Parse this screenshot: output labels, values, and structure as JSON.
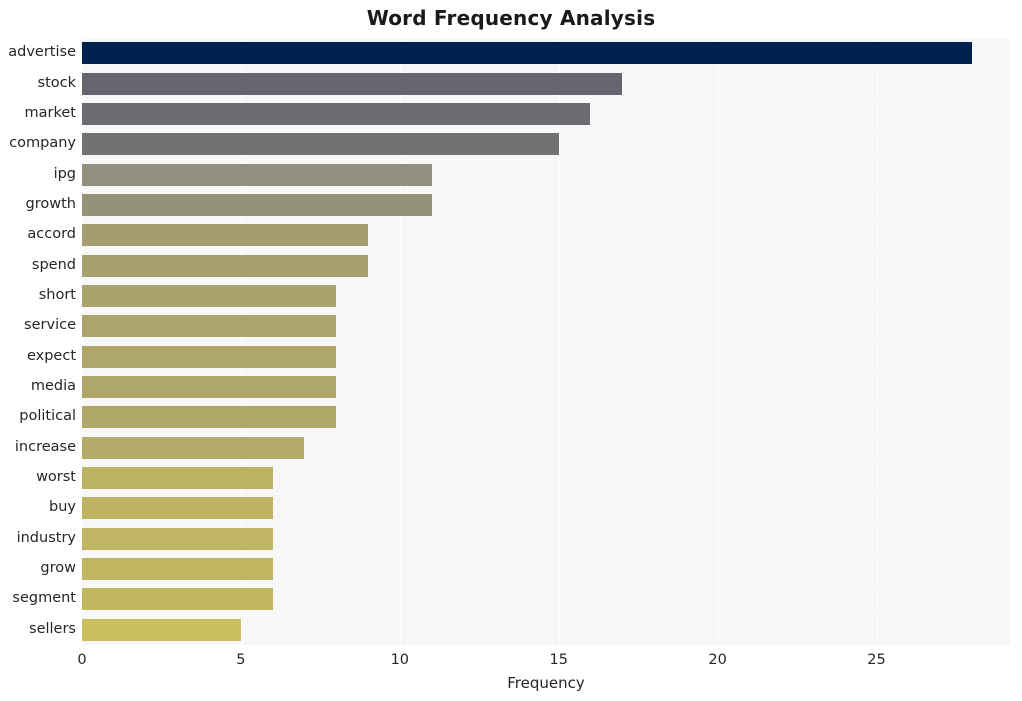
{
  "chart_data": {
    "type": "bar",
    "orientation": "horizontal",
    "title": "Word Frequency Analysis",
    "xlabel": "Frequency",
    "ylabel": "",
    "categories": [
      "advertise",
      "stock",
      "market",
      "company",
      "ipg",
      "growth",
      "accord",
      "spend",
      "short",
      "service",
      "expect",
      "media",
      "political",
      "increase",
      "worst",
      "buy",
      "industry",
      "grow",
      "segment",
      "sellers"
    ],
    "values": [
      28,
      17,
      16,
      15,
      11,
      11,
      9,
      9,
      8,
      8,
      8,
      8,
      8,
      7,
      6,
      6,
      6,
      6,
      6,
      5
    ],
    "xticks": [
      0,
      5,
      10,
      15,
      20,
      25
    ],
    "xtick_labels": [
      "0",
      "5",
      "10",
      "15",
      "20",
      "25"
    ],
    "xlim": [
      0,
      29.2
    ],
    "grid": true,
    "legend": "none",
    "bar_colors": [
      "#00224e",
      "#64656e",
      "#6b6b71",
      "#727272",
      "#918f7e",
      "#949278",
      "#a49d71",
      "#a69f70",
      "#ab a36d",
      "#aca46c",
      "#aea66b",
      "#afa76a",
      "#b0a869",
      "#b3ab67",
      "#bcb264",
      "#bdb363",
      "#bfb562",
      "#c0b661",
      "#c1b760",
      "#cbbf5d"
    ],
    "plot_background": "#f7f7f7",
    "gridline_color": "#ffffff",
    "text_color": "#262626"
  }
}
